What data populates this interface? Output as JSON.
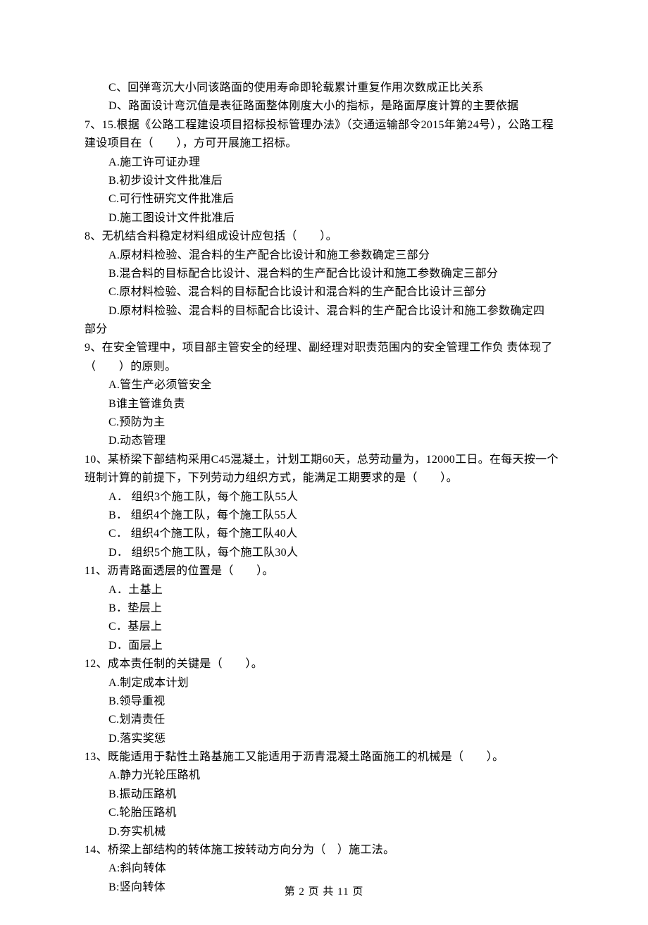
{
  "lines": [
    {
      "cls": "indent1",
      "text": "C、回弹弯沉大小同该路面的使用寿命即轮载累计重复作用次数成正比关系"
    },
    {
      "cls": "indent1",
      "text": "D、路面设计弯沉值是表征路面整体刚度大小的指标，是路面厚度计算的主要依据"
    },
    {
      "cls": "",
      "text": "7、15.根据《公路工程建设项目招标投标管理办法》（交通运输部令2015年第24号），公路工程建设项目在（　　），方可开展施工招标。"
    },
    {
      "cls": "indent1",
      "text": "A.施工许可证办理"
    },
    {
      "cls": "indent1",
      "text": "B.初步设计文件批准后"
    },
    {
      "cls": "indent1",
      "text": "C.可行性研究文件批准后"
    },
    {
      "cls": "indent1",
      "text": "D.施工图设计文件批准后"
    },
    {
      "cls": "",
      "text": "8、无机结合料稳定材料组成设计应包括（　　）。"
    },
    {
      "cls": "indent1",
      "text": "A.原材料检验、混合料的生产配合比设计和施工参数确定三部分"
    },
    {
      "cls": "indent1",
      "text": "B.混合料的目标配合比设计、混合料的生产配合比设计和施工参数确定三部分"
    },
    {
      "cls": "indent1",
      "text": "C.原材料检验、混合料的目标配合比设计和混合料的生产配合比设计三部分"
    },
    {
      "cls": "indent1",
      "text": "D.原材料检验、混合料的目标配合比设计、混合料的生产配合比设计和施工参数确定四"
    },
    {
      "cls": "",
      "text": "部分"
    },
    {
      "cls": "",
      "text": "9、在安全管理中，项目部主管安全的经理、副经理对职责范围内的安全管理工作负 责体现了（　　）的原则。"
    },
    {
      "cls": "indent1",
      "text": "A.管生产必须管安全"
    },
    {
      "cls": "indent1",
      "text": "B谁主管谁负责"
    },
    {
      "cls": "indent1",
      "text": "C.预防为主"
    },
    {
      "cls": "indent1",
      "text": "D.动态管理"
    },
    {
      "cls": "",
      "text": "10、某桥梁下部结构采用C45混凝土，计划工期60天，总劳动量为，12000工日。在每天按一个班制计算的前提下，下列劳动力组织方式，能满足工期要求的是（　　）。"
    },
    {
      "cls": "indent1",
      "text": "A． 组织3个施工队，每个施工队55人"
    },
    {
      "cls": "indent1",
      "text": "B． 组织4个施工队，每个施工队55人"
    },
    {
      "cls": "indent1",
      "text": "C． 组织4个施工队，每个施工队40人"
    },
    {
      "cls": "indent1",
      "text": "D． 组织5个施工队，每个施工队30人"
    },
    {
      "cls": "",
      "text": "11、沥青路面透层的位置是（　　）。"
    },
    {
      "cls": "indent1",
      "text": "A．土基上"
    },
    {
      "cls": "indent1",
      "text": "B．垫层上"
    },
    {
      "cls": "indent1",
      "text": "C．基层上"
    },
    {
      "cls": "indent1",
      "text": "D．面层上"
    },
    {
      "cls": "",
      "text": "12、成本责任制的关键是（　　）。"
    },
    {
      "cls": "indent1",
      "text": "A.制定成本计划"
    },
    {
      "cls": "indent1",
      "text": "B.领导重视"
    },
    {
      "cls": "indent1",
      "text": "C.划清责任"
    },
    {
      "cls": "indent1",
      "text": "D.落实奖惩"
    },
    {
      "cls": "",
      "text": "13、既能适用于黏性土路基施工又能适用于沥青混凝土路面施工的机械是（　　）。"
    },
    {
      "cls": "indent1",
      "text": "A.静力光轮压路机"
    },
    {
      "cls": "indent1",
      "text": "B.振动压路机"
    },
    {
      "cls": "indent1",
      "text": "C.轮胎压路机"
    },
    {
      "cls": "indent1",
      "text": "D.夯实机械"
    },
    {
      "cls": "",
      "text": "14、桥梁上部结构的转体施工按转动方向分为（　）施工法。"
    },
    {
      "cls": "indent1",
      "text": "A:斜向转体"
    },
    {
      "cls": "indent1",
      "text": "B:竖向转体"
    }
  ],
  "footer": "第 2 页 共 11 页"
}
